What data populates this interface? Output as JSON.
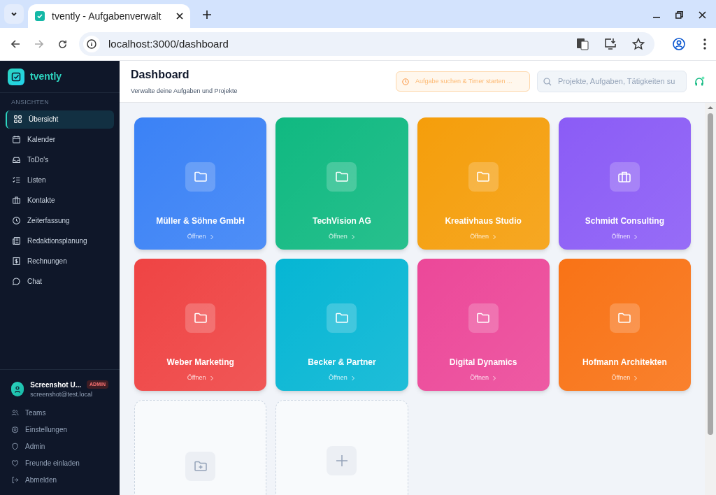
{
  "browser": {
    "tab_title": "tvently - Aufgabenverwalt",
    "url": "localhost:3000/dashboard"
  },
  "sidebar": {
    "brand": "tvently",
    "section": "ANSICHTEN",
    "items": [
      {
        "label": "Übersicht",
        "selected": true
      },
      {
        "label": "Kalender",
        "selected": false
      },
      {
        "label": "ToDo's",
        "selected": false
      },
      {
        "label": "Listen",
        "selected": false
      },
      {
        "label": "Kontakte",
        "selected": false
      },
      {
        "label": "Zeiterfassung",
        "selected": false
      },
      {
        "label": "Redaktionsplanung",
        "selected": false
      },
      {
        "label": "Rechnungen",
        "selected": false
      },
      {
        "label": "Chat",
        "selected": false
      }
    ],
    "user": {
      "name": "Screenshot U...",
      "role": "ADMIN",
      "email": "screenshot@test.local"
    },
    "footer_items": [
      "Teams",
      "Einstellungen",
      "Admin",
      "Freunde einladen",
      "Abmelden"
    ]
  },
  "header": {
    "title": "Dashboard",
    "subtitle": "Verwalte deine Aufgaben und Projekte",
    "timer_placeholder": "Aufgabe suchen & Timer starten ...",
    "search_placeholder": "Projekte, Aufgaben, Tätigkeiten su"
  },
  "projects": [
    {
      "kind": "folder",
      "name": "Müller & Söhne GmbH",
      "action": "Öffnen",
      "color": "#3b82f6"
    },
    {
      "kind": "folder",
      "name": "TechVision AG",
      "action": "Öffnen",
      "color": "#10b981"
    },
    {
      "kind": "folder",
      "name": "Kreativhaus Studio",
      "action": "Öffnen",
      "color": "#f59e0b"
    },
    {
      "kind": "briefcase",
      "name": "Schmidt Consulting",
      "action": "Öffnen",
      "color": "#8b5cf6"
    },
    {
      "kind": "folder",
      "name": "Weber Marketing",
      "action": "Öffnen",
      "color": "#ef4444"
    },
    {
      "kind": "folder",
      "name": "Becker & Partner",
      "action": "Öffnen",
      "color": "#06b6d4"
    },
    {
      "kind": "folder",
      "name": "Digital Dynamics",
      "action": "Öffnen",
      "color": "#ec4899"
    },
    {
      "kind": "folder",
      "name": "Hofmann Architekten",
      "action": "Öffnen",
      "color": "#f97316"
    },
    {
      "kind": "new-folder"
    },
    {
      "kind": "new"
    }
  ]
}
